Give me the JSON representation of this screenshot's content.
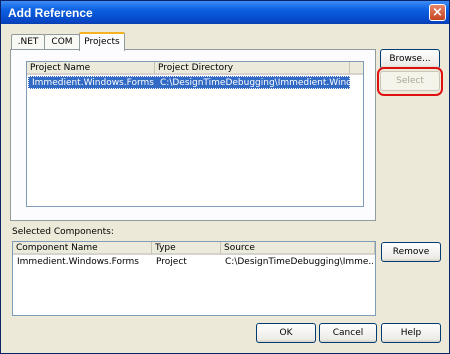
{
  "dialog": {
    "title": "Add Reference",
    "close_glyph": "×"
  },
  "tabs": [
    {
      "label": ".NET",
      "active": false
    },
    {
      "label": "COM",
      "active": false
    },
    {
      "label": "Projects",
      "active": true
    }
  ],
  "projects_list": {
    "columns": [
      "Project Name",
      "Project Directory"
    ],
    "rows": [
      {
        "name": "Immedient.Windows.Forms",
        "directory": "C:\\DesignTimeDebugging\\Immedient.Windows...",
        "selected": true
      }
    ]
  },
  "side_buttons": {
    "browse": "Browse...",
    "select": "Select",
    "remove": "Remove"
  },
  "selected_components": {
    "label": "Selected Components:",
    "columns": [
      "Component Name",
      "Type",
      "Source"
    ],
    "rows": [
      {
        "name": "Immedient.Windows.Forms",
        "type": "Project",
        "source": "C:\\DesignTimeDebugging\\Imme..."
      }
    ]
  },
  "footer_buttons": {
    "ok": "OK",
    "cancel": "Cancel",
    "help": "Help"
  },
  "colors": {
    "selection": "#316ac5",
    "callout": "#e01010",
    "title_bar": "#0a5fe0"
  }
}
